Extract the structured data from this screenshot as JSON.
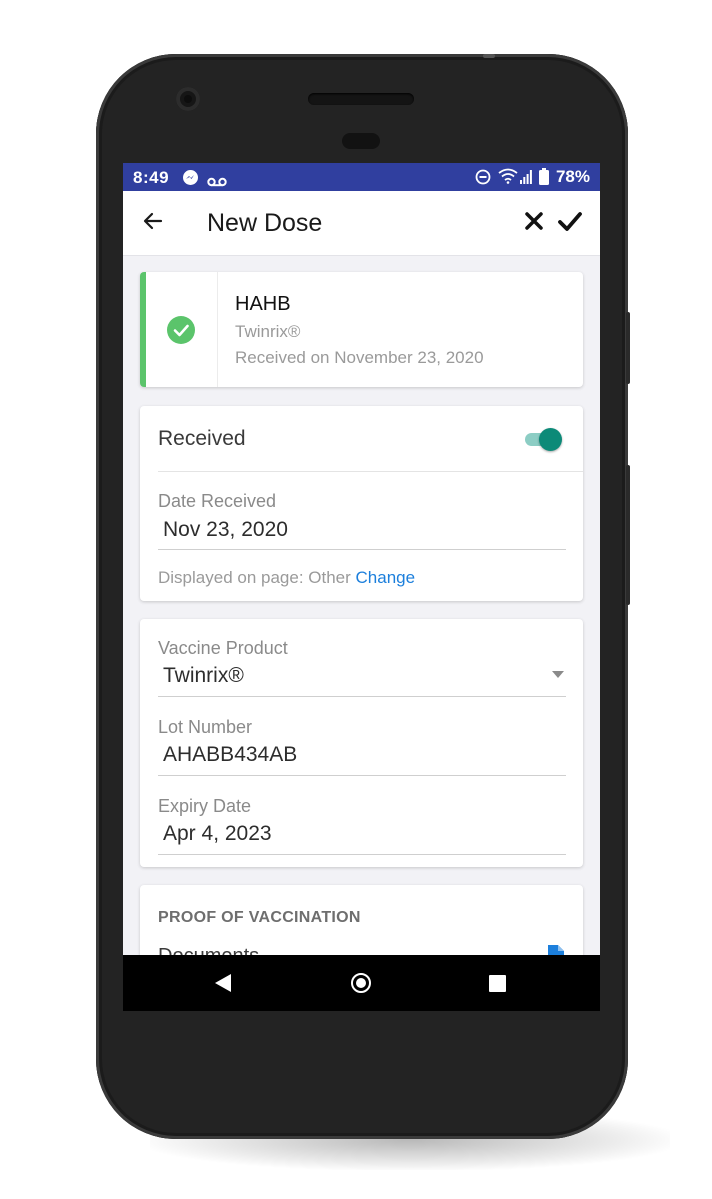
{
  "status_bar": {
    "time": "8:49",
    "icons": [
      "messenger-icon",
      "voicemail-icon",
      "do-not-disturb-icon",
      "wifi-icon",
      "signal-icon",
      "battery-icon"
    ],
    "battery": "78%"
  },
  "app_bar": {
    "title": "New Dose",
    "icons": [
      "back-arrow-icon",
      "close-icon",
      "check-icon"
    ]
  },
  "summary": {
    "name": "HAHB",
    "product": "Twinrix®",
    "received_on": "Received on November 23, 2020",
    "status_icon": "check-circle-icon"
  },
  "received": {
    "label": "Received",
    "toggle_on": true,
    "date_label": "Date Received",
    "date_value": "Nov 23, 2020",
    "displayed_on_text": "Displayed on page: Other ",
    "change_link": "Change"
  },
  "product_details": {
    "vaccine_product_label": "Vaccine Product",
    "vaccine_product_value": "Twinrix®",
    "lot_number_label": "Lot Number",
    "lot_number_value": "AHABB434AB",
    "expiry_date_label": "Expiry Date",
    "expiry_date_value": "Apr 4, 2023"
  },
  "proof": {
    "heading": "PROOF OF VACCINATION",
    "documents_label": "Documents"
  },
  "colors": {
    "status_bar": "#303f9f",
    "accent_green": "#5bc46b",
    "toggle_teal": "#0c8a78",
    "link_blue": "#1c7fdc"
  }
}
